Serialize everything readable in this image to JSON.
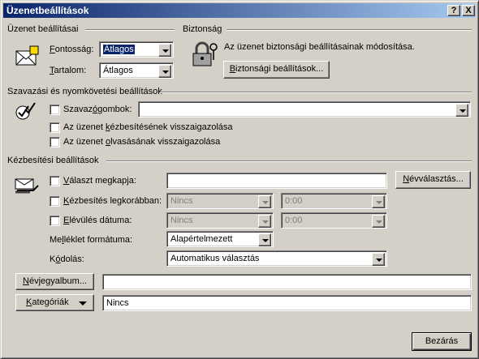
{
  "window": {
    "title": "Üzenetbeállítások",
    "help_btn": "?",
    "close_btn": "X"
  },
  "message_settings": {
    "heading": "Üzenet beállításai",
    "importance_label_u": "F",
    "importance_label_rest": "ontosság:",
    "importance_value": "Átlagos",
    "sensitivity_label_u": "T",
    "sensitivity_label_rest": "artalom:",
    "sensitivity_value": "Átlagos"
  },
  "security": {
    "heading": "Biztonság",
    "description": "Az üzenet biztonsági beállításainak módosítása.",
    "button_u": "B",
    "button_rest": "iztonsági beállítások..."
  },
  "voting": {
    "heading": "Szavazási és nyomkövetési beállítások",
    "vote_label_pre": "Szavaz",
    "vote_label_u": "ó",
    "vote_label_post": "gombok:",
    "vote_value": "",
    "delivery_pre": "Az üzenet ",
    "delivery_u": "k",
    "delivery_post": "ézbesítésének visszaigazolása",
    "read_pre": "Az üzenet ",
    "read_u": "o",
    "read_post": "lvasásának visszaigazolása"
  },
  "delivery": {
    "heading": "Kézbesítési beállítások",
    "replies_u": "V",
    "replies_rest": "álaszt megkapja:",
    "replies_value": "",
    "names_button_u": "N",
    "names_button_rest": "évválasztás...",
    "defer_u": "K",
    "defer_rest": "ézbesítés legkorábban:",
    "defer_date": "Nincs",
    "defer_time": "0:00",
    "expire_u": "E",
    "expire_rest": "lévülés dátuma:",
    "expire_date": "Nincs",
    "expire_time": "0:00",
    "attach_pre": "Me",
    "attach_u": "l",
    "attach_post": "léklet formátuma:",
    "attach_value": "Alapértelmezett",
    "encoding_pre": "K",
    "encoding_u": "ó",
    "encoding_post": "dolás:",
    "encoding_value": "Automatikus választás"
  },
  "footer": {
    "contacts_u": "N",
    "contacts_rest": "évjegyalbum...",
    "contacts_value": "",
    "categories_u": "K",
    "categories_rest": "ategóriák",
    "categories_value": "Nincs",
    "close_button": "Bezárás"
  },
  "icons": [
    "envelope-settings-icon",
    "padlock-keys-icon",
    "voting-checkmarks-icon",
    "delivery-hand-icon"
  ]
}
